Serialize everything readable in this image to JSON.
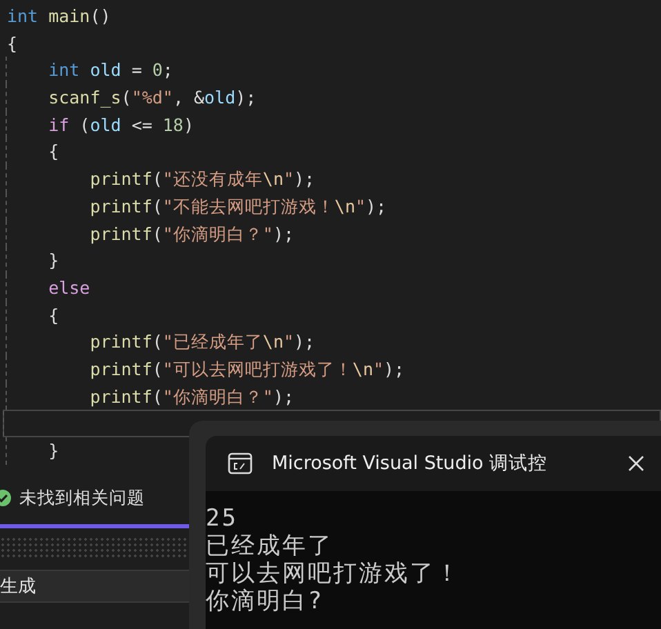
{
  "code_lines": [
    {
      "current": false,
      "tokens": [
        {
          "t": "int",
          "kind": "kw"
        },
        {
          "t": " main",
          "kind": "fn"
        },
        {
          "t": "()",
          "kind": "p"
        }
      ]
    },
    {
      "current": false,
      "tokens": [
        {
          "t": "{",
          "kind": "p"
        }
      ]
    },
    {
      "current": false,
      "tokens": [
        {
          "t": "    int",
          "kind": "kw"
        },
        {
          "t": " old",
          "kind": "id"
        },
        {
          "t": " = ",
          "kind": "p"
        },
        {
          "t": "0",
          "kind": "num"
        },
        {
          "t": ";",
          "kind": "p"
        }
      ]
    },
    {
      "current": false,
      "tokens": [
        {
          "t": "    scanf_s",
          "kind": "fn"
        },
        {
          "t": "(",
          "kind": "p"
        },
        {
          "t": "\"%d\"",
          "kind": "str"
        },
        {
          "t": ", &",
          "kind": "p"
        },
        {
          "t": "old",
          "kind": "id"
        },
        {
          "t": ");",
          "kind": "p"
        }
      ]
    },
    {
      "current": false,
      "tokens": [
        {
          "t": "    if",
          "kind": "ctl"
        },
        {
          "t": " (",
          "kind": "p"
        },
        {
          "t": "old",
          "kind": "id"
        },
        {
          "t": " <= ",
          "kind": "p"
        },
        {
          "t": "18",
          "kind": "num"
        },
        {
          "t": ")",
          "kind": "p"
        }
      ]
    },
    {
      "current": false,
      "tokens": [
        {
          "t": "    {",
          "kind": "p"
        }
      ]
    },
    {
      "current": false,
      "tokens": [
        {
          "t": "        printf",
          "kind": "fn"
        },
        {
          "t": "(",
          "kind": "p"
        },
        {
          "t": "\"还没有成年",
          "kind": "str"
        },
        {
          "t": "\\n",
          "kind": "esc"
        },
        {
          "t": "\"",
          "kind": "str"
        },
        {
          "t": ");",
          "kind": "p"
        }
      ]
    },
    {
      "current": false,
      "tokens": [
        {
          "t": "        printf",
          "kind": "fn"
        },
        {
          "t": "(",
          "kind": "p"
        },
        {
          "t": "\"不能去网吧打游戏！",
          "kind": "str"
        },
        {
          "t": "\\n",
          "kind": "esc"
        },
        {
          "t": "\"",
          "kind": "str"
        },
        {
          "t": ");",
          "kind": "p"
        }
      ]
    },
    {
      "current": false,
      "tokens": [
        {
          "t": "        printf",
          "kind": "fn"
        },
        {
          "t": "(",
          "kind": "p"
        },
        {
          "t": "\"你滴明白？\"",
          "kind": "str"
        },
        {
          "t": ");",
          "kind": "p"
        }
      ]
    },
    {
      "current": false,
      "tokens": [
        {
          "t": "    }",
          "kind": "p"
        }
      ]
    },
    {
      "current": false,
      "tokens": [
        {
          "t": "    else",
          "kind": "ctl"
        }
      ]
    },
    {
      "current": false,
      "tokens": [
        {
          "t": "    {",
          "kind": "p"
        }
      ]
    },
    {
      "current": false,
      "tokens": [
        {
          "t": "        printf",
          "kind": "fn"
        },
        {
          "t": "(",
          "kind": "p"
        },
        {
          "t": "\"已经成年了",
          "kind": "str"
        },
        {
          "t": "\\n",
          "kind": "esc"
        },
        {
          "t": "\"",
          "kind": "str"
        },
        {
          "t": ");",
          "kind": "p"
        }
      ]
    },
    {
      "current": false,
      "tokens": [
        {
          "t": "        printf",
          "kind": "fn"
        },
        {
          "t": "(",
          "kind": "p"
        },
        {
          "t": "\"可以去网吧打游戏了！",
          "kind": "str"
        },
        {
          "t": "\\n",
          "kind": "esc"
        },
        {
          "t": "\"",
          "kind": "str"
        },
        {
          "t": ");",
          "kind": "p"
        }
      ]
    },
    {
      "current": false,
      "tokens": [
        {
          "t": "        printf",
          "kind": "fn"
        },
        {
          "t": "(",
          "kind": "p"
        },
        {
          "t": "\"你滴明白？\"",
          "kind": "str"
        },
        {
          "t": ");",
          "kind": "p"
        }
      ]
    },
    {
      "current": true
    },
    {
      "current": false,
      "tokens": [
        {
          "t": "    }",
          "kind": "p"
        }
      ]
    }
  ],
  "status": {
    "text": "未找到相关问题",
    "ok": true
  },
  "output_panel": {
    "title": "生成"
  },
  "console": {
    "title": "Microsoft Visual Studio 调试控",
    "lines": [
      "25",
      "已经成年了",
      "可以去网吧打游戏了！",
      "你滴明白?"
    ]
  }
}
